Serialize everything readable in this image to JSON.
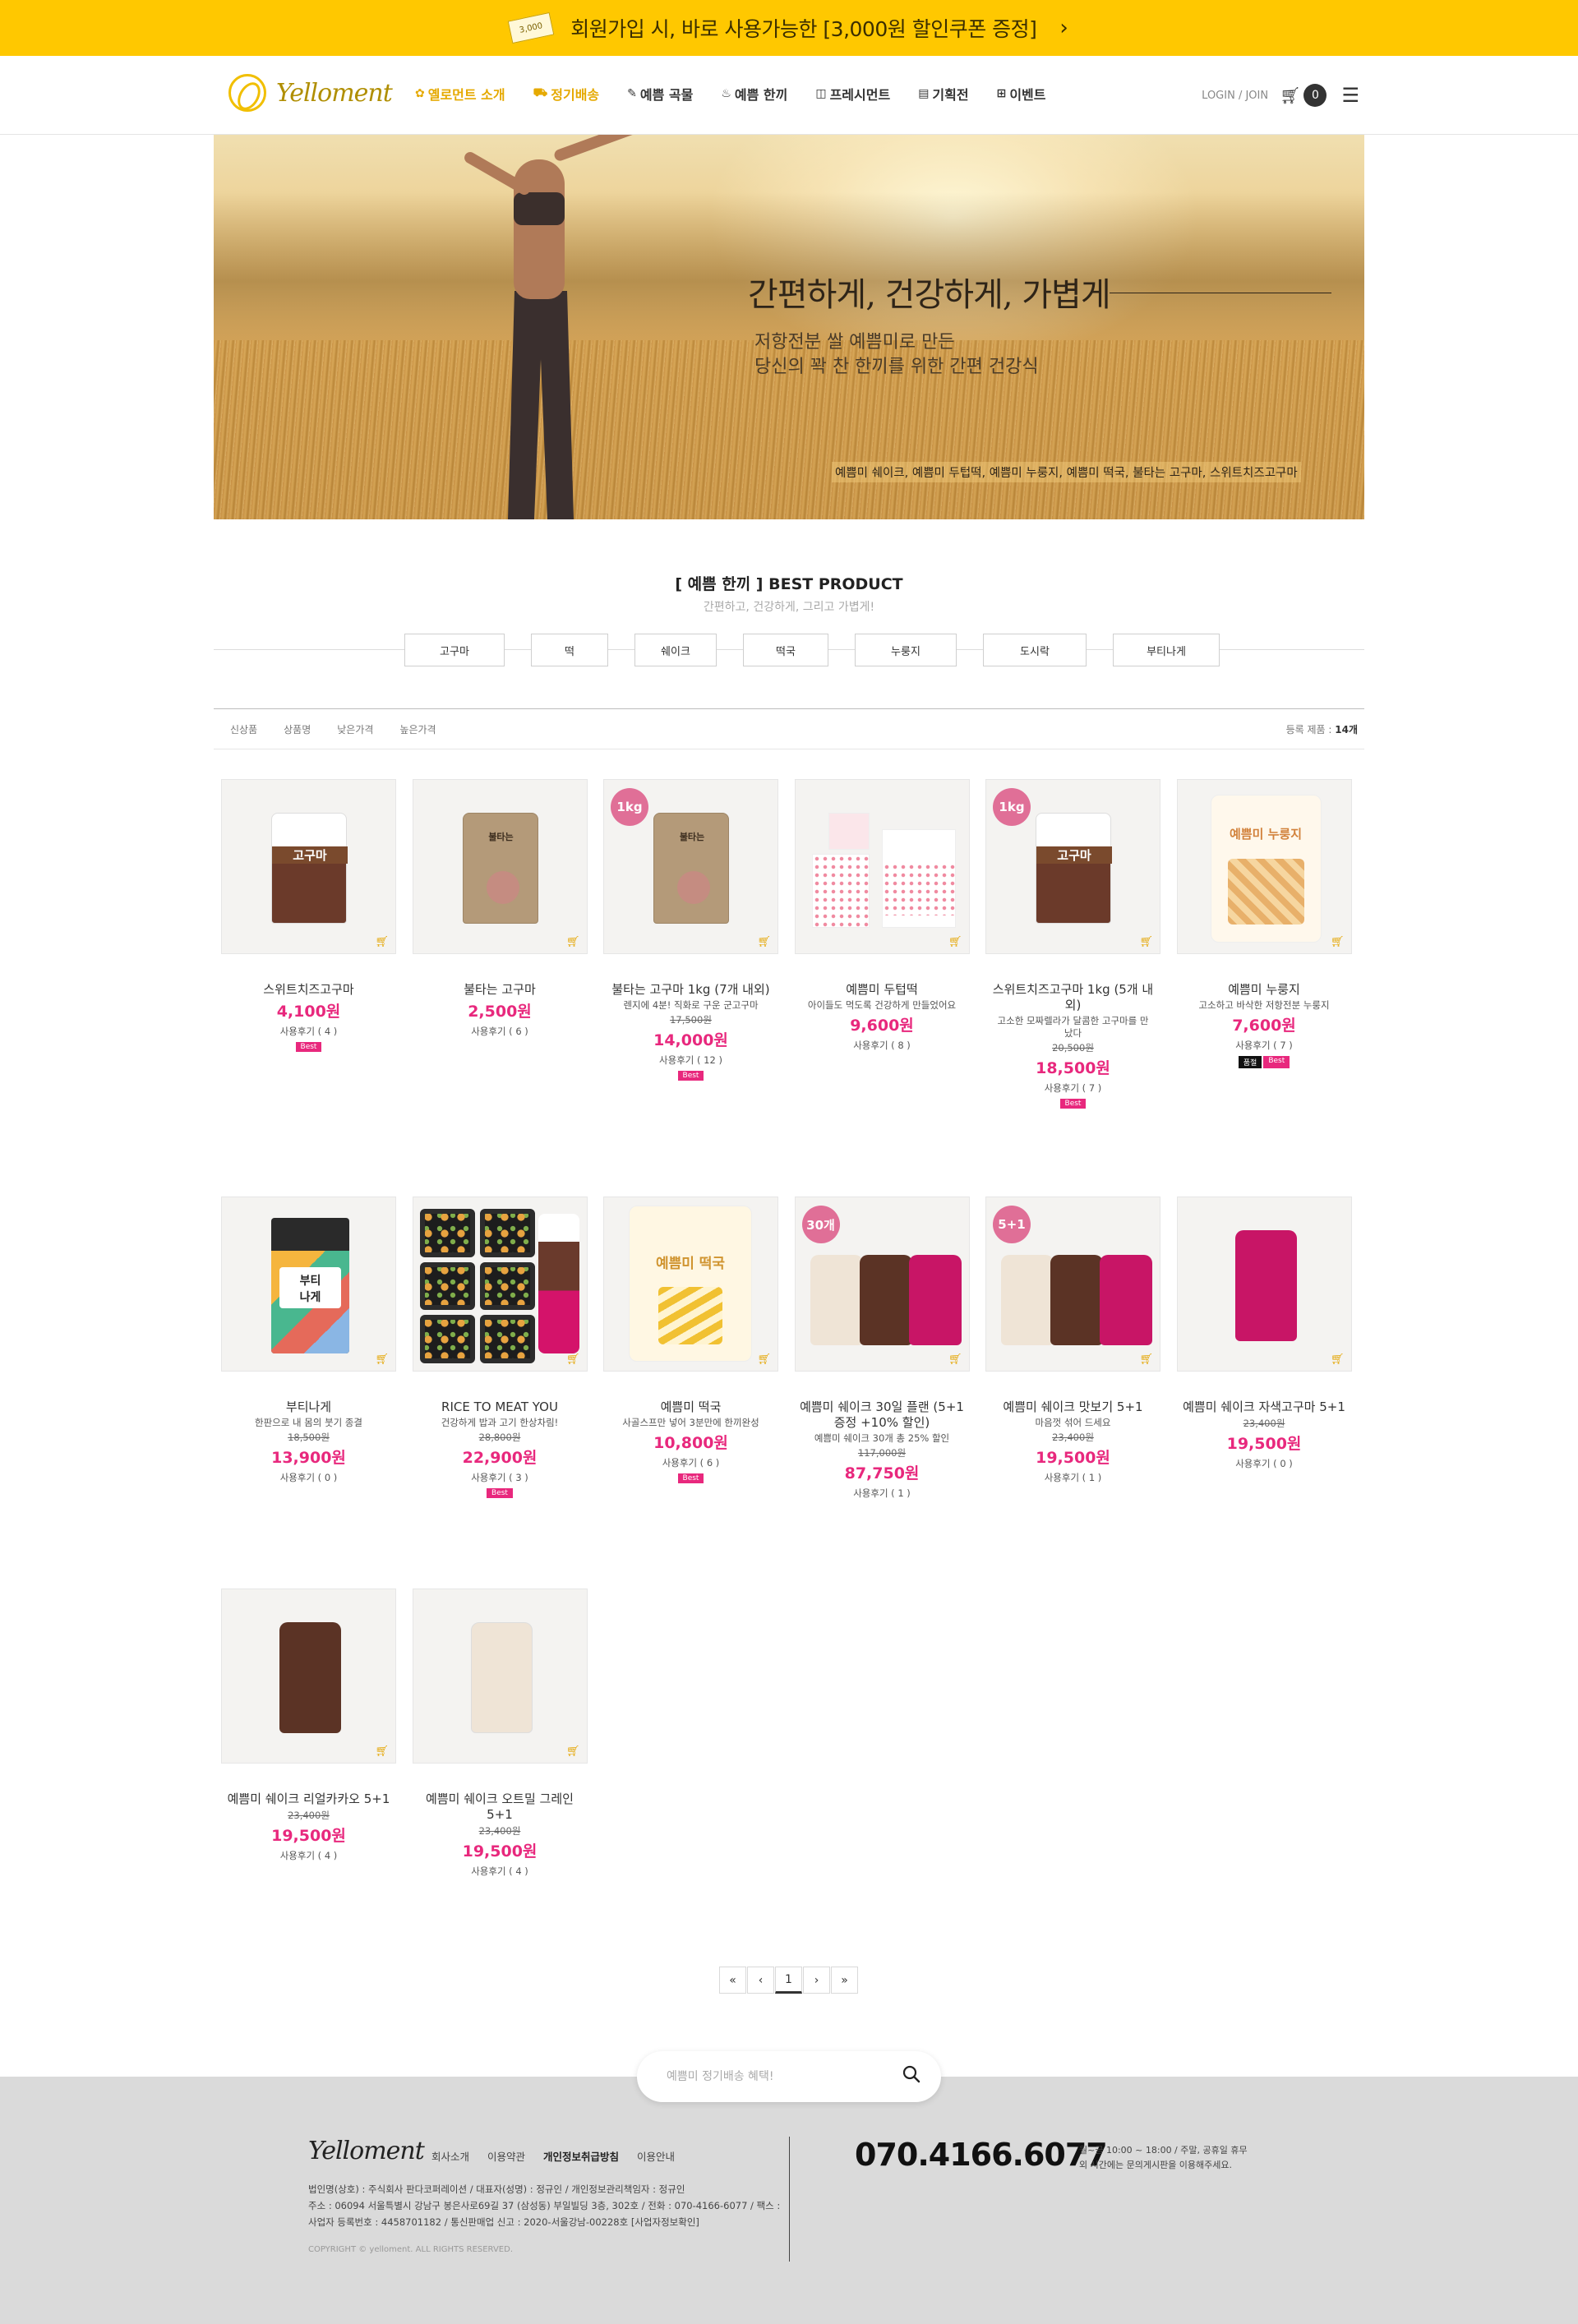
{
  "promo": {
    "coupon_label": "3,000",
    "text": "회원가입 시, 바로 사용가능한 [3,000원 할인쿠폰 증정]",
    "arrow": "›"
  },
  "header": {
    "logo": "Yelloment",
    "nav": [
      {
        "label": "옐로먼트 소개",
        "icon": "✿",
        "highlight": true
      },
      {
        "label": "정기배송",
        "icon": "⛟",
        "highlight": true
      },
      {
        "label": "예쁨 곡물",
        "icon": "✎",
        "highlight": false
      },
      {
        "label": "예쁨 한끼",
        "icon": "♨",
        "highlight": false
      },
      {
        "label": "프레시먼트",
        "icon": "◫",
        "highlight": false
      },
      {
        "label": "기획전",
        "icon": "▤",
        "highlight": false
      },
      {
        "label": "이벤트",
        "icon": "⊞",
        "highlight": false
      }
    ],
    "login": "LOGIN / JOIN",
    "cart_count": "0"
  },
  "hero": {
    "title": "간편하게, 건강하게, 가볍게",
    "subtitle": "저항전분 쌀 예쁨미로 만든\n당신의 꽉 찬 한끼를 위한 간편 건강식",
    "foot": "예쁨미 쉐이크, 예쁨미 두텁떡, 예쁨미 누룽지, 예쁨미 떡국, 불타는 고구마, 스위트치즈고구마"
  },
  "section": {
    "title": "[ 예쁨 한끼 ] BEST PRODUCT",
    "subtitle": "간편하고, 건강하게, 그리고 가볍게!",
    "tabs": [
      "고구마",
      "떡",
      "쉐이크",
      "떡국",
      "누룽지",
      "도시락",
      "부티나게"
    ],
    "sort": [
      "신상품",
      "상품명",
      "낮은가격",
      "높은가격"
    ],
    "count_label": "등록 제품 : ",
    "count_value": "14개"
  },
  "products": [
    {
      "name": "스위트치즈고구마",
      "desc": "",
      "old_price": "",
      "price": "4,100원",
      "reviews": "사용후기 ( 4 )",
      "tags": [
        "Best"
      ],
      "badge": "",
      "thumb": "sweet"
    },
    {
      "name": "불타는 고구마",
      "desc": "",
      "old_price": "",
      "price": "2,500원",
      "reviews": "사용후기 ( 6 )",
      "tags": [],
      "badge": "",
      "thumb": "kraft"
    },
    {
      "name": "불타는 고구마 1kg (7개 내외)",
      "desc": "렌지에 4분! 직화로 구운 군고구마",
      "old_price": "17,500원",
      "price": "14,000원",
      "reviews": "사용후기 ( 12 )",
      "tags": [
        "Best"
      ],
      "badge": "1kg",
      "thumb": "kraft"
    },
    {
      "name": "예쁨미 두텁떡",
      "desc": "아이들도 먹도록 건강하게 만들었어요",
      "old_price": "",
      "price": "9,600원",
      "reviews": "사용후기 ( 8 )",
      "tags": [],
      "badge": "",
      "thumb": "ricecake"
    },
    {
      "name": "스위트치즈고구마 1kg (5개 내외)",
      "desc": "고소한 모짜렐라가 달콤한 고구마를 만났다",
      "old_price": "20,500원",
      "price": "18,500원",
      "reviews": "사용후기 ( 7 )",
      "tags": [
        "Best"
      ],
      "badge": "1kg",
      "thumb": "sweet"
    },
    {
      "name": "예쁨미 누룽지",
      "desc": "고소하고 바삭한 저항전분 누룽지",
      "old_price": "",
      "price": "7,600원",
      "reviews": "사용후기 ( 7 )",
      "tags": [
        "품절",
        "Best"
      ],
      "badge": "",
      "thumb": "nurungji"
    },
    {
      "name": "부티나게",
      "desc": "한판으로 내 몸의 붓기 종결",
      "old_price": "18,500원",
      "price": "13,900원",
      "reviews": "사용후기 ( 0 )",
      "tags": [],
      "badge": "",
      "thumb": "booty"
    },
    {
      "name": "RICE TO MEAT YOU",
      "desc": "건강하게 밥과 고기 한상차림!",
      "old_price": "28,800원",
      "price": "22,900원",
      "reviews": "사용후기 ( 3 )",
      "tags": [
        "Best"
      ],
      "badge": "",
      "thumb": "lunchbox"
    },
    {
      "name": "예쁨미 떡국",
      "desc": "사골스프만 넣어 3분만에 한끼완성",
      "old_price": "",
      "price": "10,800원",
      "reviews": "사용후기 ( 6 )",
      "tags": [
        "Best"
      ],
      "badge": "",
      "thumb": "tteokguk"
    },
    {
      "name": "예쁨미 쉐이크 30일 플랜 (5+1증정 +10% 할인)",
      "desc": "예쁨미 쉐이크 30개 총 25% 할인",
      "old_price": "117,000원",
      "price": "87,750원",
      "reviews": "사용후기 ( 1 )",
      "tags": [],
      "badge": "30개",
      "thumb": "shake3"
    },
    {
      "name": "예쁨미 쉐이크 맛보기 5+1",
      "desc": "마음껏 섞어 드세요",
      "old_price": "23,400원",
      "price": "19,500원",
      "reviews": "사용후기 ( 1 )",
      "tags": [],
      "badge": "5+1",
      "thumb": "shake3"
    },
    {
      "name": "예쁨미 쉐이크 자색고구마 5+1",
      "desc": "",
      "old_price": "23,400원",
      "price": "19,500원",
      "reviews": "사용후기 ( 0 )",
      "tags": [],
      "badge": "",
      "thumb": "shake_purple"
    },
    {
      "name": "예쁨미 쉐이크 리얼카카오 5+1",
      "desc": "",
      "old_price": "23,400원",
      "price": "19,500원",
      "reviews": "사용후기 ( 4 )",
      "tags": [],
      "badge": "",
      "thumb": "shake_cocoa"
    },
    {
      "name": "예쁨미 쉐이크 오트밀 그레인 5+1",
      "desc": "",
      "old_price": "23,400원",
      "price": "19,500원",
      "reviews": "사용후기 ( 4 )",
      "tags": [],
      "badge": "",
      "thumb": "shake_oat"
    }
  ],
  "pagination": [
    "«",
    "‹",
    "1",
    "›",
    "»"
  ],
  "footer": {
    "search_placeholder": "예쁨미 정기배송 혜택!",
    "logo": "Yelloment",
    "links": [
      "회사소개",
      "이용약관",
      "개인정보취급방침",
      "이용안내"
    ],
    "info": [
      "법인명(상호) : 주식회사 판다코퍼레이션 / 대표자(성명) : 정규인 / 개인정보관리책임자 : 정규인",
      "주소 : 06094 서울특별시 강남구 봉은사로69길 37 (삼성동) 부일빌딩 3층, 302호 / 전화 : 070-4166-6077 / 팩스 :",
      "사업자 등록번호 : 4458701182 / 통신판매업 신고 : 2020-서울강남-00228호 [사업자정보확인]"
    ],
    "copyright": "COPYRIGHT © yelloment. ALL RIGHTS RESERVED.",
    "phone": "070.4166.6077",
    "hours": "월~금 10:00 ~ 18:00 / 주말, 공휴일 휴무\n외 시간에는 문의게시판을 이용해주세요."
  }
}
